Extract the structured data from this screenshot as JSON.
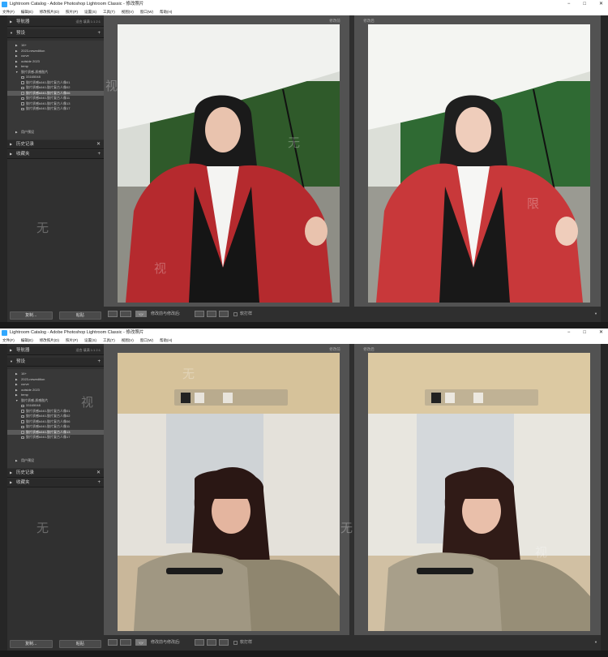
{
  "app_title": "Lightroom Catalog - Adobe Photoshop Lightroom Classic - 修改照片",
  "window_controls": [
    "−",
    "□",
    "✕"
  ],
  "menu": [
    "文件(F)",
    "编辑(E)",
    "修改照片(D)",
    "照片(P)",
    "设置(S)",
    "工具(T)",
    "视图(V)",
    "窗口(W)",
    "帮助(H)"
  ],
  "panels": {
    "navigator": "导航器",
    "navigator_options": "适合  填满  1:1  2:1",
    "presets": "预设",
    "history": "历史记录",
    "collections": "收藏夹"
  },
  "preset_folders": [
    "16+",
    "2023-newedition",
    "curve",
    "outside 2023",
    "temp",
    "胶片质感-质感胶片"
  ],
  "preset_items": [
    "33165048",
    "胶片质感k040-胶片复古人像01",
    "胶片质感k040-胶片复古人像02",
    "胶片质感k040-胶片复古人像06",
    "胶片质感k040-胶片复古人像11",
    "胶片质感k040-胶片复古人像13",
    "胶片质感k040-胶片复古人像17"
  ],
  "user_presets": "用户预设",
  "buttons": {
    "copy": "复制...",
    "paste": "粘贴"
  },
  "view_labels": {
    "before": "修改前",
    "after": "修改后"
  },
  "toolbar": {
    "yy_label": "Y|Y",
    "before_after": "修改前与修改后:",
    "soft_proof": "软打样"
  },
  "watermark_chars": [
    "无",
    "限",
    "视"
  ],
  "screens": [
    {
      "id": "top",
      "selected_preset_index": 3
    },
    {
      "id": "bottom",
      "selected_preset_index": 5
    }
  ],
  "colors": {
    "panel_bg": "#303030",
    "photo1_coat": "#b52a2e",
    "photo1_foliage": "#2f5a2a",
    "photo2_bus_wall": "#d6c29a"
  }
}
